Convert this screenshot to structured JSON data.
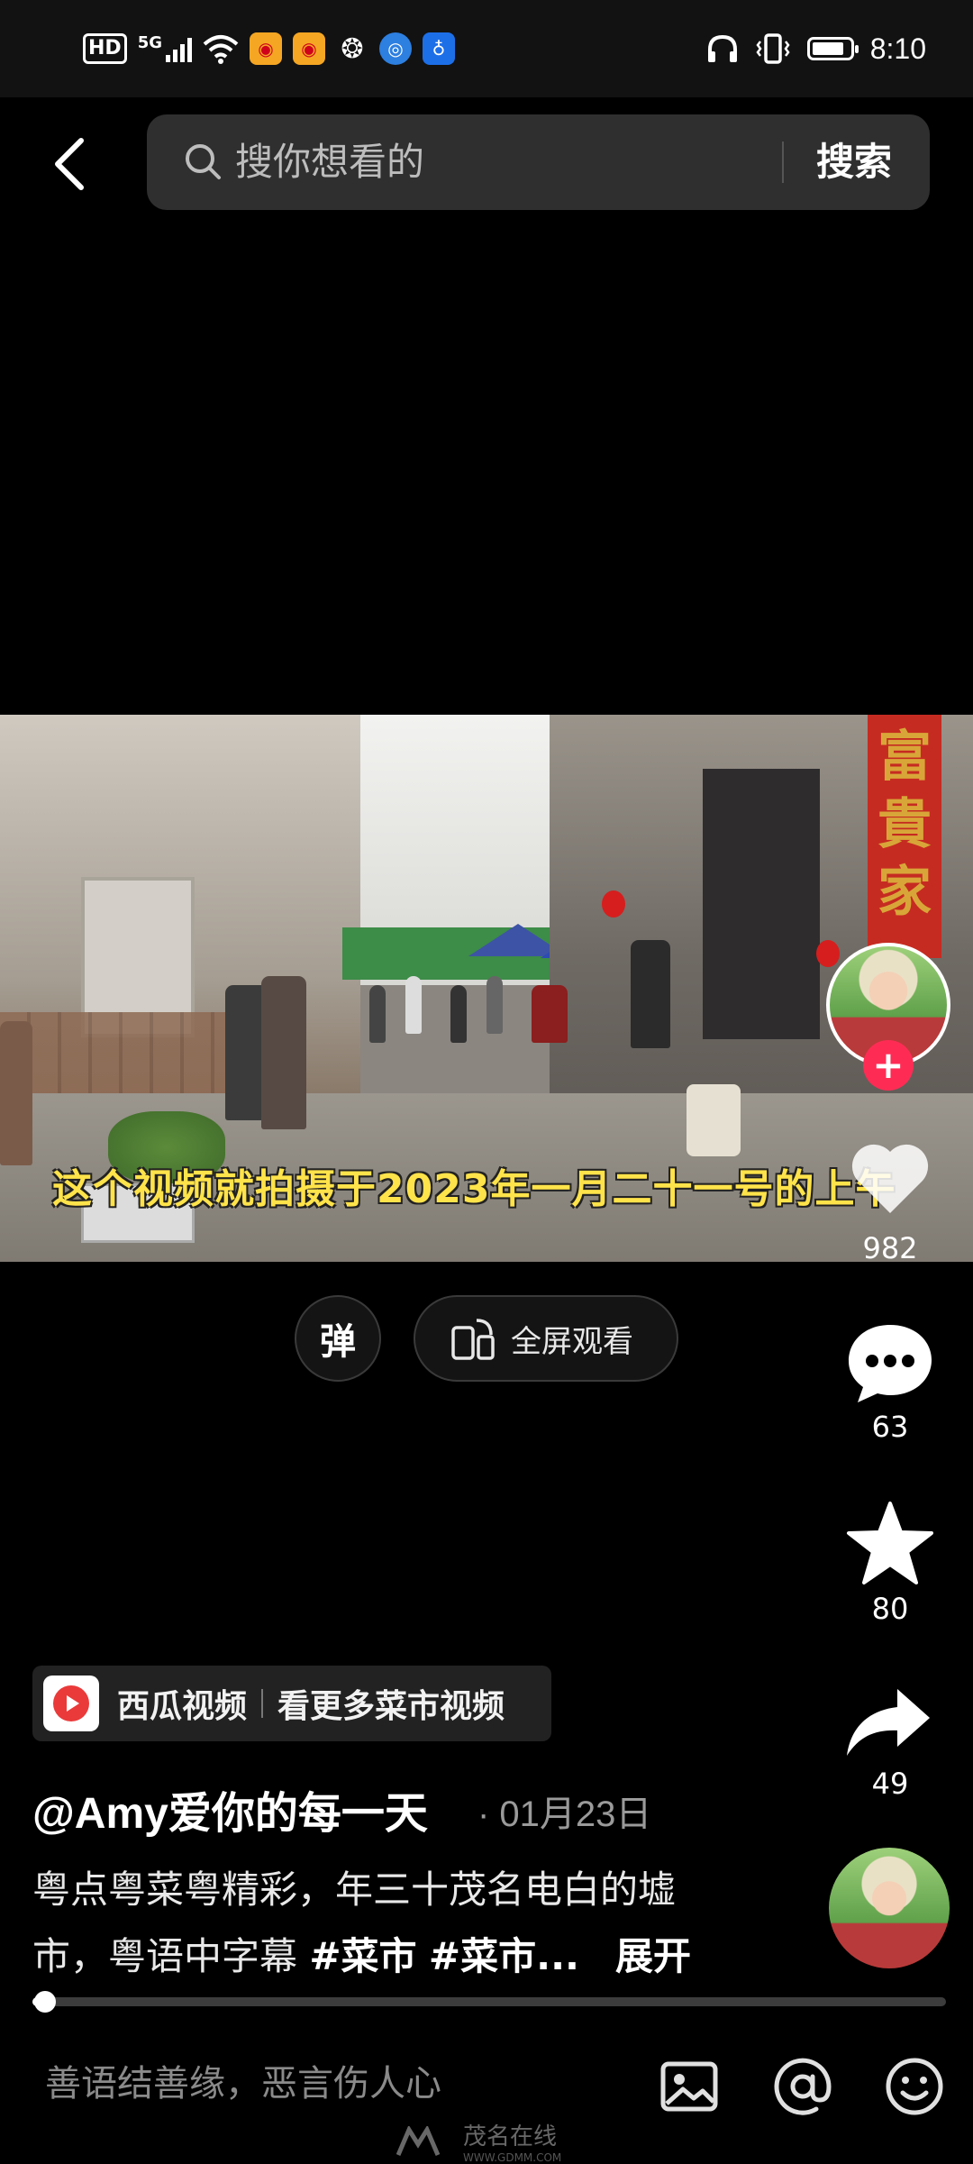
{
  "status_bar": {
    "time": "8:10",
    "network": "5G",
    "hd_label": "HD",
    "battery_level": 0.85,
    "notification_icons": [
      "weibo-icon",
      "weibo-icon",
      "wechat-icon",
      "browser-icon",
      "bulb-icon"
    ],
    "status_icons": [
      "headphones-icon",
      "vibrate-icon",
      "battery-icon"
    ]
  },
  "header": {
    "search_placeholder": "搜你想看的",
    "search_button": "搜索"
  },
  "video": {
    "subtitle": "这个视频就拍摄于2023年一月二十一号的上午",
    "couplet_text": "富貴家"
  },
  "actions": {
    "like_count": "982",
    "comment_count": "63",
    "favorite_count": "80",
    "share_count": "49"
  },
  "player_controls": {
    "danmu_label": "弹",
    "fullscreen_label": "全屏观看"
  },
  "banner": {
    "app_name": "西瓜视频",
    "more_label": "看更多菜市视频"
  },
  "post": {
    "author": "@Amy爱你的每一天",
    "date": "· 01月23日",
    "description_line1": "粤点粤菜粤精彩，年三十茂名电白的墟",
    "description_line2_prefix": "市，粤语中字幕 ",
    "tags": [
      "#菜市",
      "#菜市..."
    ],
    "expand_label": "展开",
    "progress": 0.01
  },
  "comment_bar": {
    "placeholder": "善语结善缘，恶言伤人心",
    "icons": [
      "image-icon",
      "mention-icon",
      "emoji-icon"
    ]
  },
  "watermark": {
    "text": "茂名在线",
    "sub": "WWW.GDMM.COM"
  },
  "colors": {
    "accent": "#fe2c55",
    "subtitle": "#ffe34a",
    "background": "#000000"
  }
}
